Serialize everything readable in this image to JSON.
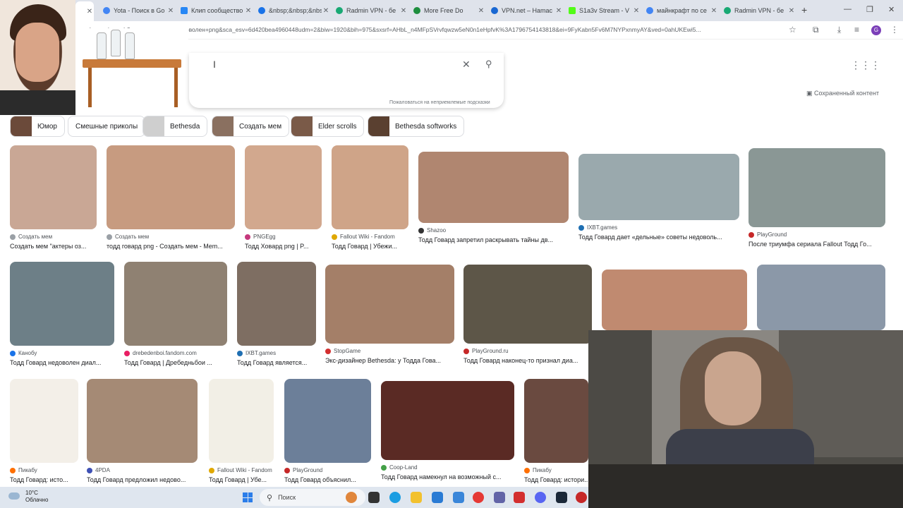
{
  "tabs": [
    {
      "title": "",
      "color": "#dfe3eb",
      "active": true
    },
    {
      "title": "Yota - Поиск в Go",
      "color": "#4285f4"
    },
    {
      "title": "Клип сообщество",
      "color": "#2787f5"
    },
    {
      "title": "&nbsp;&nbsp;&nbsp;:",
      "color": "#1a73e8"
    },
    {
      "title": "Radmin VPN - бе",
      "color": "#19a974"
    },
    {
      "title": "More Free Do",
      "color": "#1e8e3e"
    },
    {
      "title": "VPN.net – Hamac",
      "color": "#1967d2"
    },
    {
      "title": "S1a3v Stream - V",
      "color": "#53fc18"
    },
    {
      "title": "майнкрафт по се",
      "color": "#4285f4"
    },
    {
      "title": "Radmin VPN - бе",
      "color": "#19a974"
    }
  ],
  "address_url": "google.com/search?q=тодд+говард+недоволен+png&sca_esv=6d420bea4960448udm=2&biw=1920&bih=975&sxsrf=AHbL_n4MFpSVrvfqwzw5eN0n1eHpfvK%3A1796754143818&ei=9FyKabn5Fv6M7NYPxnmyAY&ved=0ahUKEwi5...",
  "search": {
    "cursor": "I",
    "report_text": "Пожаловаться на неприемлемые подсказки"
  },
  "saved_content": "Сохраненный контент",
  "chips": [
    {
      "label": "Юмор",
      "thumb": "#6b4a3a"
    },
    {
      "label": "Смешные приколы",
      "thumb": ""
    },
    {
      "label": "Bethesda",
      "thumb": "#cfcfcf"
    },
    {
      "label": "Создать мем",
      "thumb": "#8a7060"
    },
    {
      "label": "Elder scrolls",
      "thumb": "#7a5a48"
    },
    {
      "label": "Bethesda softworks",
      "thumb": "#5a4030"
    }
  ],
  "results": [
    {
      "source": "Создать мем",
      "title": "Создать мем \"актеры оз...",
      "bg": "#c9a795",
      "dot": "#9aa0a6"
    },
    {
      "source": "Создать мем",
      "title": "тодд говард png - Создать мем - Mem...",
      "bg": "#c79b80",
      "dot": "#9aa0a6"
    },
    {
      "source": "PNGEgg",
      "title": "Тодд Ховард png | P...",
      "bg": "#d2a88e",
      "dot": "#c5397d"
    },
    {
      "source": "Fallout Wiki - Fandom",
      "title": "Тодд Говард | Убежи...",
      "bg": "#cfa488",
      "dot": "#e0a800"
    },
    {
      "source": "Shazoo",
      "title": "Тодд Говард запретил раскрывать тайны дв...",
      "bg": "#b08670",
      "dot": "#333333"
    },
    {
      "source": "IXBT.games",
      "title": "Тодд Говард дает «дельные» советы недоволь...",
      "bg": "#9aa9ad",
      "dot": "#1f6fb2"
    },
    {
      "source": "PlayGround",
      "title": "После триумфа сериала Fallout Тодд Го...",
      "bg": "#8a9795",
      "dot": "#c62828"
    },
    {
      "source": "Канобу",
      "title": "Тодд Говард недоволен диал...",
      "bg": "#6d7f87",
      "dot": "#1a73e8"
    },
    {
      "source": "drebedenboi.fandom.com",
      "title": "Тодд Говард | Дребедньбои ...",
      "bg": "#8f8172",
      "dot": "#e91e63"
    },
    {
      "source": "IXBT.games",
      "title": "Тодд Говард является...",
      "bg": "#7e6e62",
      "dot": "#1f6fb2"
    },
    {
      "source": "StopGame",
      "title": "Экс-дизайнер Bethesda: у Тодда Гова...",
      "bg": "#a47f68",
      "dot": "#d32f2f"
    },
    {
      "source": "PlayGround.ru",
      "title": "Тодд Говард наконец-то признал диа...",
      "bg": "#5d5648",
      "dot": "#c62828"
    },
    {
      "source": "",
      "title": "",
      "bg": "#c08a70",
      "dot": "#ffffff"
    },
    {
      "source": "",
      "title": "",
      "bg": "#8b98a8",
      "dot": "#ffffff"
    },
    {
      "source": "Пикабу",
      "title": "Тодд Говард: исто...",
      "bg": "#f3efe8",
      "dot": "#ff6f00"
    },
    {
      "source": "4PDA",
      "title": "Тодд Говард предложил недово...",
      "bg": "#a58a75",
      "dot": "#3f51b5"
    },
    {
      "source": "Fallout Wiki - Fandom",
      "title": "Тодд Говард | Убе...",
      "bg": "#f2efe6",
      "dot": "#e0a800"
    },
    {
      "source": "PlayGround",
      "title": "Тодд Говард объяснил...",
      "bg": "#6c7f99",
      "dot": "#c62828"
    },
    {
      "source": "Coop-Land",
      "title": "Тодд Говард намекнул на возможный с...",
      "bg": "#5a2a24",
      "dot": "#43a047"
    },
    {
      "source": "Пикабу",
      "title": "Тодд Говард: истори...",
      "bg": "#6a4a40",
      "dot": "#ff6f00"
    }
  ],
  "taskbar": {
    "temperature": "10°C",
    "condition": "Облачно",
    "search_placeholder": "Поиск"
  }
}
